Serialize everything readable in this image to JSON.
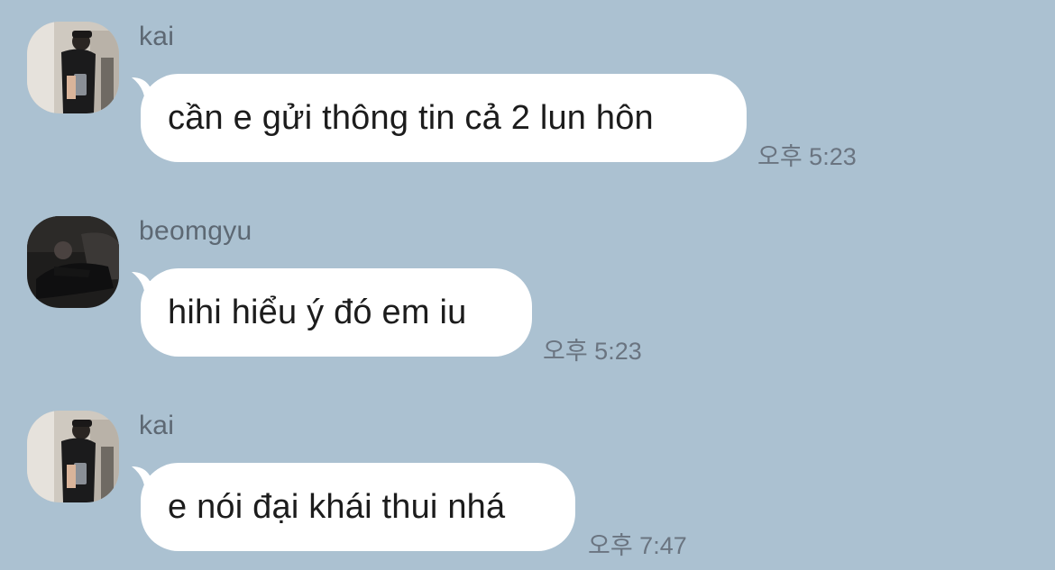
{
  "colors": {
    "background": "#abc1d1",
    "bubble": "#ffffff",
    "sender_text": "#5d6873",
    "time_text": "#6a7480"
  },
  "messages": [
    {
      "sender": "kai",
      "avatar": "kai-avatar",
      "text": "cần e gửi thông tin cả 2 lun hôn",
      "time": "오후 5:23"
    },
    {
      "sender": "beomgyu",
      "avatar": "beomgyu-avatar",
      "text": "hihi hiểu ý đó em iu",
      "time": "오후 5:23"
    },
    {
      "sender": "kai",
      "avatar": "kai-avatar",
      "text": "e nói đại khái thui nhá",
      "time": "오후 7:47"
    }
  ]
}
